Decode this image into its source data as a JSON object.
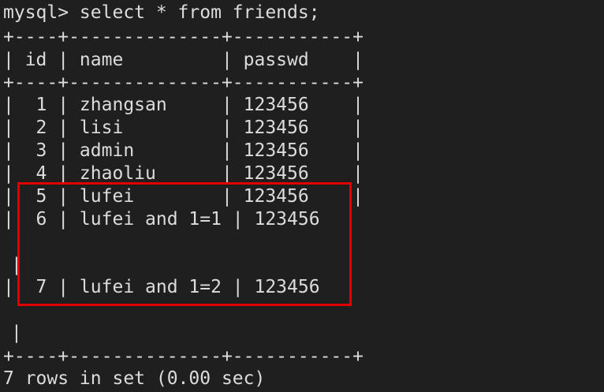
{
  "terminal": {
    "prompt": "mysql> select * from friends;",
    "border": "+----+--------------+-----------+",
    "header_row": "| id | name         | passwd    |",
    "rows": [
      "|  1 | zhangsan     | 123456    |",
      "|  2 | lisi         | 123456    |",
      "|  3 | admin        | 123456    |",
      "|  4 | zhaoliu      | 123456    |",
      "|  5 | lufei        | 123456    |",
      "|  6 | lufei and 1=1 | 123456",
      "|  7 | lufei and 1=2 | 123456"
    ],
    "footer": "7 rows in set (0.00 sec)",
    "stray_bar": "|"
  },
  "colors": {
    "background": "#1f1f1f",
    "text": "#dcdcdc",
    "highlight": "#e00000"
  }
}
